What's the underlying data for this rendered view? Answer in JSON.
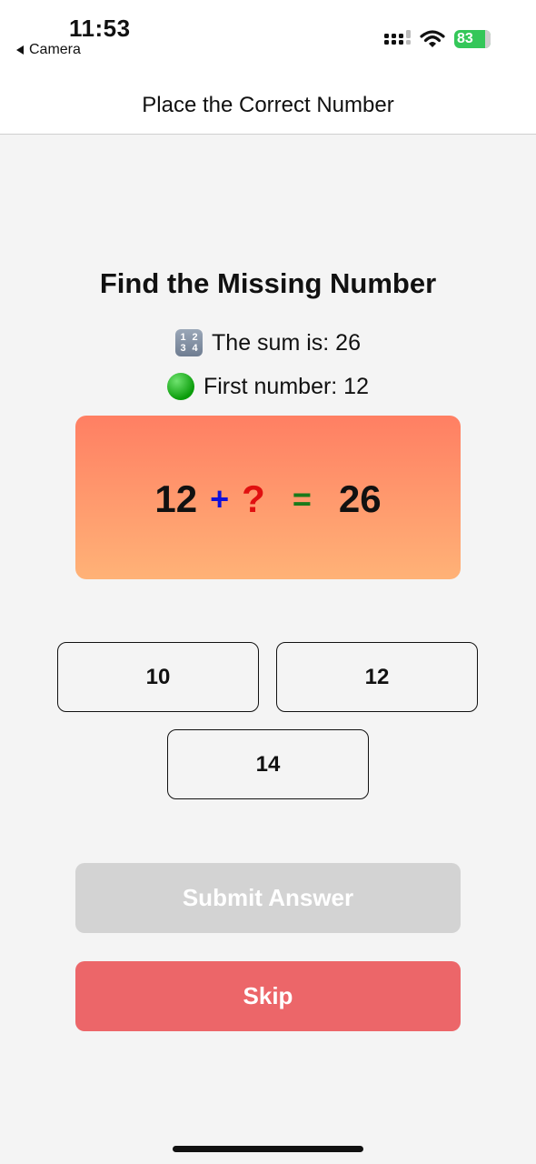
{
  "status_bar": {
    "time": "11:53",
    "back_label": "Camera",
    "battery_level": "83",
    "icons": [
      "signal-icon",
      "wifi-icon",
      "battery-icon"
    ]
  },
  "nav": {
    "title": "Place the Correct Number"
  },
  "puzzle": {
    "heading": "Find the Missing Number",
    "sum_text": "The sum is: 26",
    "first_text": "First number: 12",
    "numbers_icon_digits": [
      "1",
      "2",
      "3",
      "4"
    ]
  },
  "equation": {
    "first": "12",
    "operator": "+",
    "unknown": "?",
    "equals": "=",
    "result": "26"
  },
  "options": [
    "10",
    "12",
    "14"
  ],
  "actions": {
    "submit_label": "Submit Answer",
    "skip_label": "Skip"
  },
  "colors": {
    "card_top": "#ff7f63",
    "card_bottom": "#ffb277",
    "operator": "#1010d8",
    "unknown": "#e01010",
    "equals": "#1a7a1a",
    "submit_disabled": "#d3d3d3",
    "skip": "#ec6669",
    "battery": "#34c759"
  }
}
